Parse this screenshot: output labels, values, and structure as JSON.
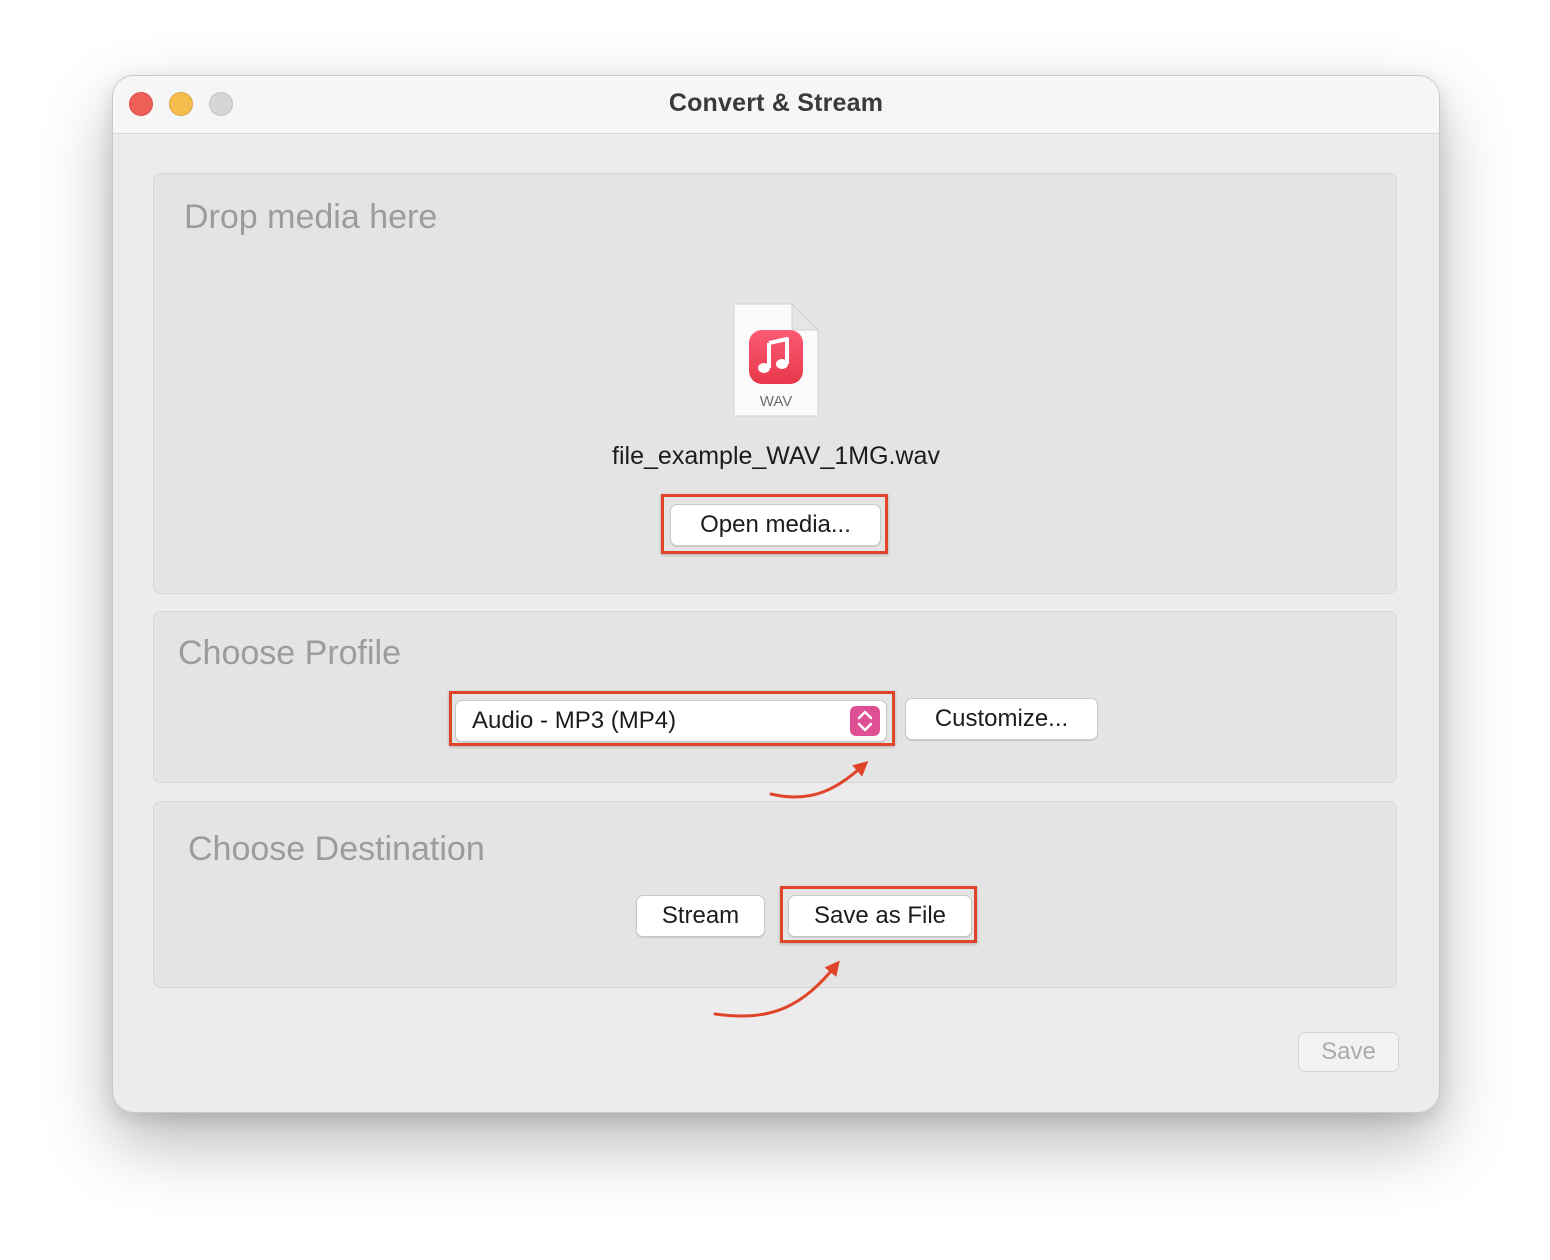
{
  "window": {
    "title": "Convert & Stream"
  },
  "drop_panel": {
    "heading": "Drop media here",
    "file_type_label": "WAV",
    "file_name": "file_example_WAV_1MG.wav",
    "open_button_label": "Open media..."
  },
  "profile_panel": {
    "heading": "Choose Profile",
    "selected_profile": "Audio - MP3 (MP4)",
    "customize_button_label": "Customize..."
  },
  "destination_panel": {
    "heading": "Choose Destination",
    "stream_button_label": "Stream",
    "save_as_file_button_label": "Save as File"
  },
  "footer": {
    "save_button_label": "Save"
  },
  "icons": {
    "file": "wav-file-icon",
    "music": "music-note-icon",
    "stepper": "chevron-up-down-icon"
  },
  "colors": {
    "highlight": "#e0442b",
    "music_icon": "#f0475a",
    "stepper": "#de4f93"
  }
}
